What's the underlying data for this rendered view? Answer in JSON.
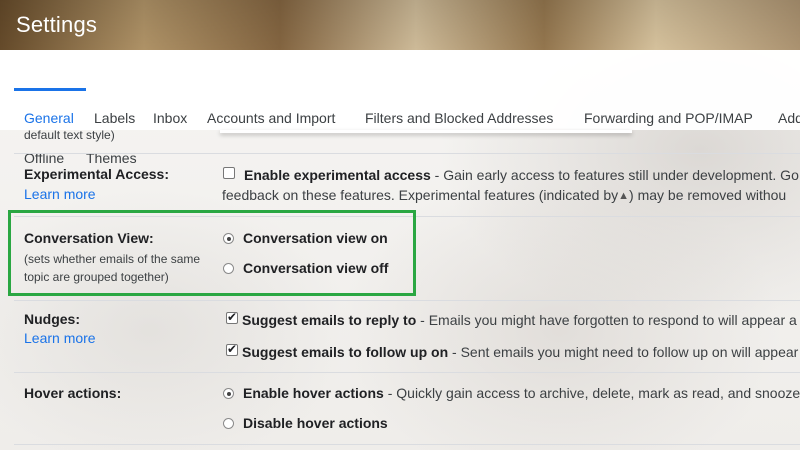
{
  "app": {
    "title": "Settings"
  },
  "tabs": {
    "row1": [
      "General",
      "Labels",
      "Inbox",
      "Accounts and Import",
      "Filters and Blocked Addresses",
      "Forwarding and POP/IMAP",
      "Add"
    ],
    "row2": [
      "Offline",
      "Themes"
    ]
  },
  "prev_setting": {
    "text": "default text style)"
  },
  "experimental": {
    "label": "Experimental Access:",
    "learn_more": "Learn more",
    "checkbox_label": "Enable experimental access",
    "desc1": " - Gain early access to features still under development. Go",
    "desc2a": "feedback on these features. Experimental features (indicated by",
    "desc2b": ") may be removed withou",
    "checked": false
  },
  "conversation": {
    "label": "Conversation View:",
    "sub1": "(sets whether emails of the same",
    "sub2": "topic are grouped together)",
    "option_on": "Conversation view on",
    "option_off": "Conversation view off",
    "selected": "on"
  },
  "nudges": {
    "label": "Nudges:",
    "learn_more": "Learn more",
    "opt1_label": "Suggest emails to reply to",
    "opt1_desc": " - Emails you might have forgotten to respond to will appear a",
    "opt2_label": "Suggest emails to follow up on",
    "opt2_desc": " - Sent emails you might need to follow up on will appear",
    "opt1_checked": true,
    "opt2_checked": true
  },
  "hover": {
    "label": "Hover actions:",
    "opt_enable": "Enable hover actions",
    "opt_enable_desc": " - Quickly gain access to archive, delete, mark as read, and snooze",
    "opt_disable": "Disable hover actions",
    "selected": "enable"
  },
  "colors": {
    "accent": "#1a73e8",
    "highlight": "#2aa742"
  },
  "icons": {
    "experimental": "flask-icon"
  }
}
